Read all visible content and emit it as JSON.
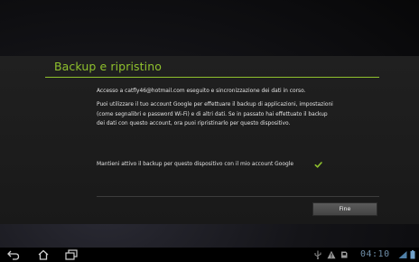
{
  "dialog": {
    "title": "Backup e ripristino",
    "account_status": "Accesso a catfly46@hotmail.com eseguito e sincronizzazione dei dati in corso.",
    "description": "Puoi utilizzare il tuo account Google per effettuare il backup di applicazioni, impostazioni (come segnalibri e password Wi-Fi) e di altri dati. Se in passato hai effettuato il backup dei dati con questo account, ora puoi ripristinarlo per questo dispositivo.",
    "backup_option_label": "Mantieni attivo il backup per questo dispositivo con il mio account Google",
    "backup_option_checked": true,
    "finish_button": "Fine"
  },
  "status_bar": {
    "clock": "04:10"
  },
  "icons": {
    "nav": [
      "back-icon",
      "home-icon",
      "recent-apps-icon"
    ],
    "status": [
      "usb-icon",
      "warning-icon",
      "sd-card-icon",
      "wifi-icon",
      "battery-icon"
    ]
  },
  "colors": {
    "accent": "#8fc12d",
    "clock": "#6f8ea8"
  }
}
